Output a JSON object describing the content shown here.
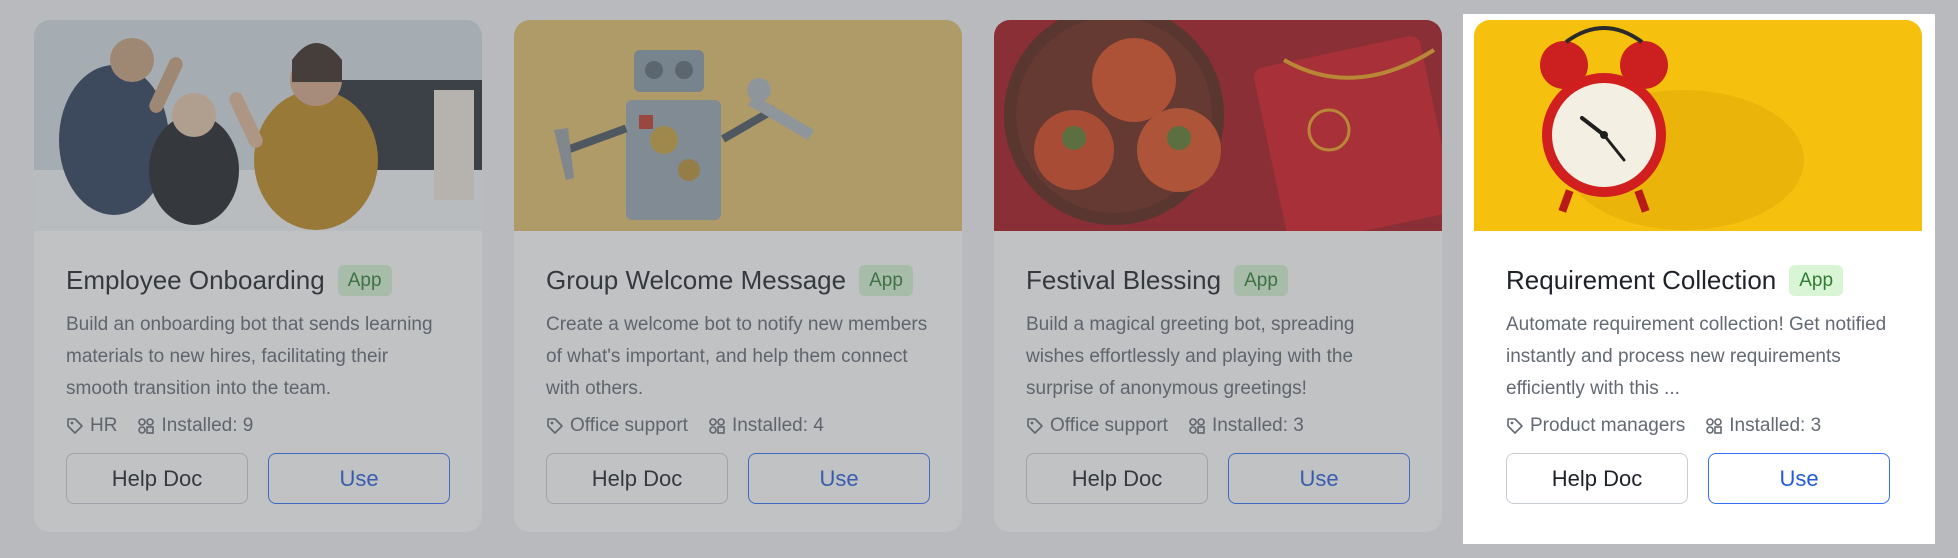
{
  "cards": [
    {
      "title": "Employee Onboarding",
      "badge": "App",
      "description": "Build an onboarding bot that sends learning materials to new hires, facilitating their smooth transition into the team.",
      "tag": "HR",
      "installed": "Installed: 9",
      "help_label": "Help Doc",
      "use_label": "Use",
      "image_icon": "team-high-five-photo"
    },
    {
      "title": "Group Welcome Message",
      "badge": "App",
      "description": "Create a welcome bot to notify new members of what's important, and help them connect with others.",
      "tag": "Office support",
      "installed": "Installed: 4",
      "help_label": "Help Doc",
      "use_label": "Use",
      "image_icon": "robot-with-tools-photo"
    },
    {
      "title": "Festival Blessing",
      "badge": "App",
      "description": "Build a magical greeting bot, spreading wishes effortlessly and playing with the surprise of anonymous greetings!",
      "tag": "Office support",
      "installed": "Installed: 3",
      "help_label": "Help Doc",
      "use_label": "Use",
      "image_icon": "persimmons-red-envelope-photo"
    },
    {
      "title": "Requirement Collection",
      "badge": "App",
      "description": "Automate requirement collection! Get notified instantly and process new requirements efficiently with this ...",
      "tag": "Product managers",
      "installed": "Installed: 3",
      "help_label": "Help Doc",
      "use_label": "Use",
      "image_icon": "alarm-clock-photo"
    }
  ],
  "colors": {
    "accent": "#3370ff",
    "badge_bg": "#d9f5d6",
    "badge_text": "#2e7d32"
  }
}
